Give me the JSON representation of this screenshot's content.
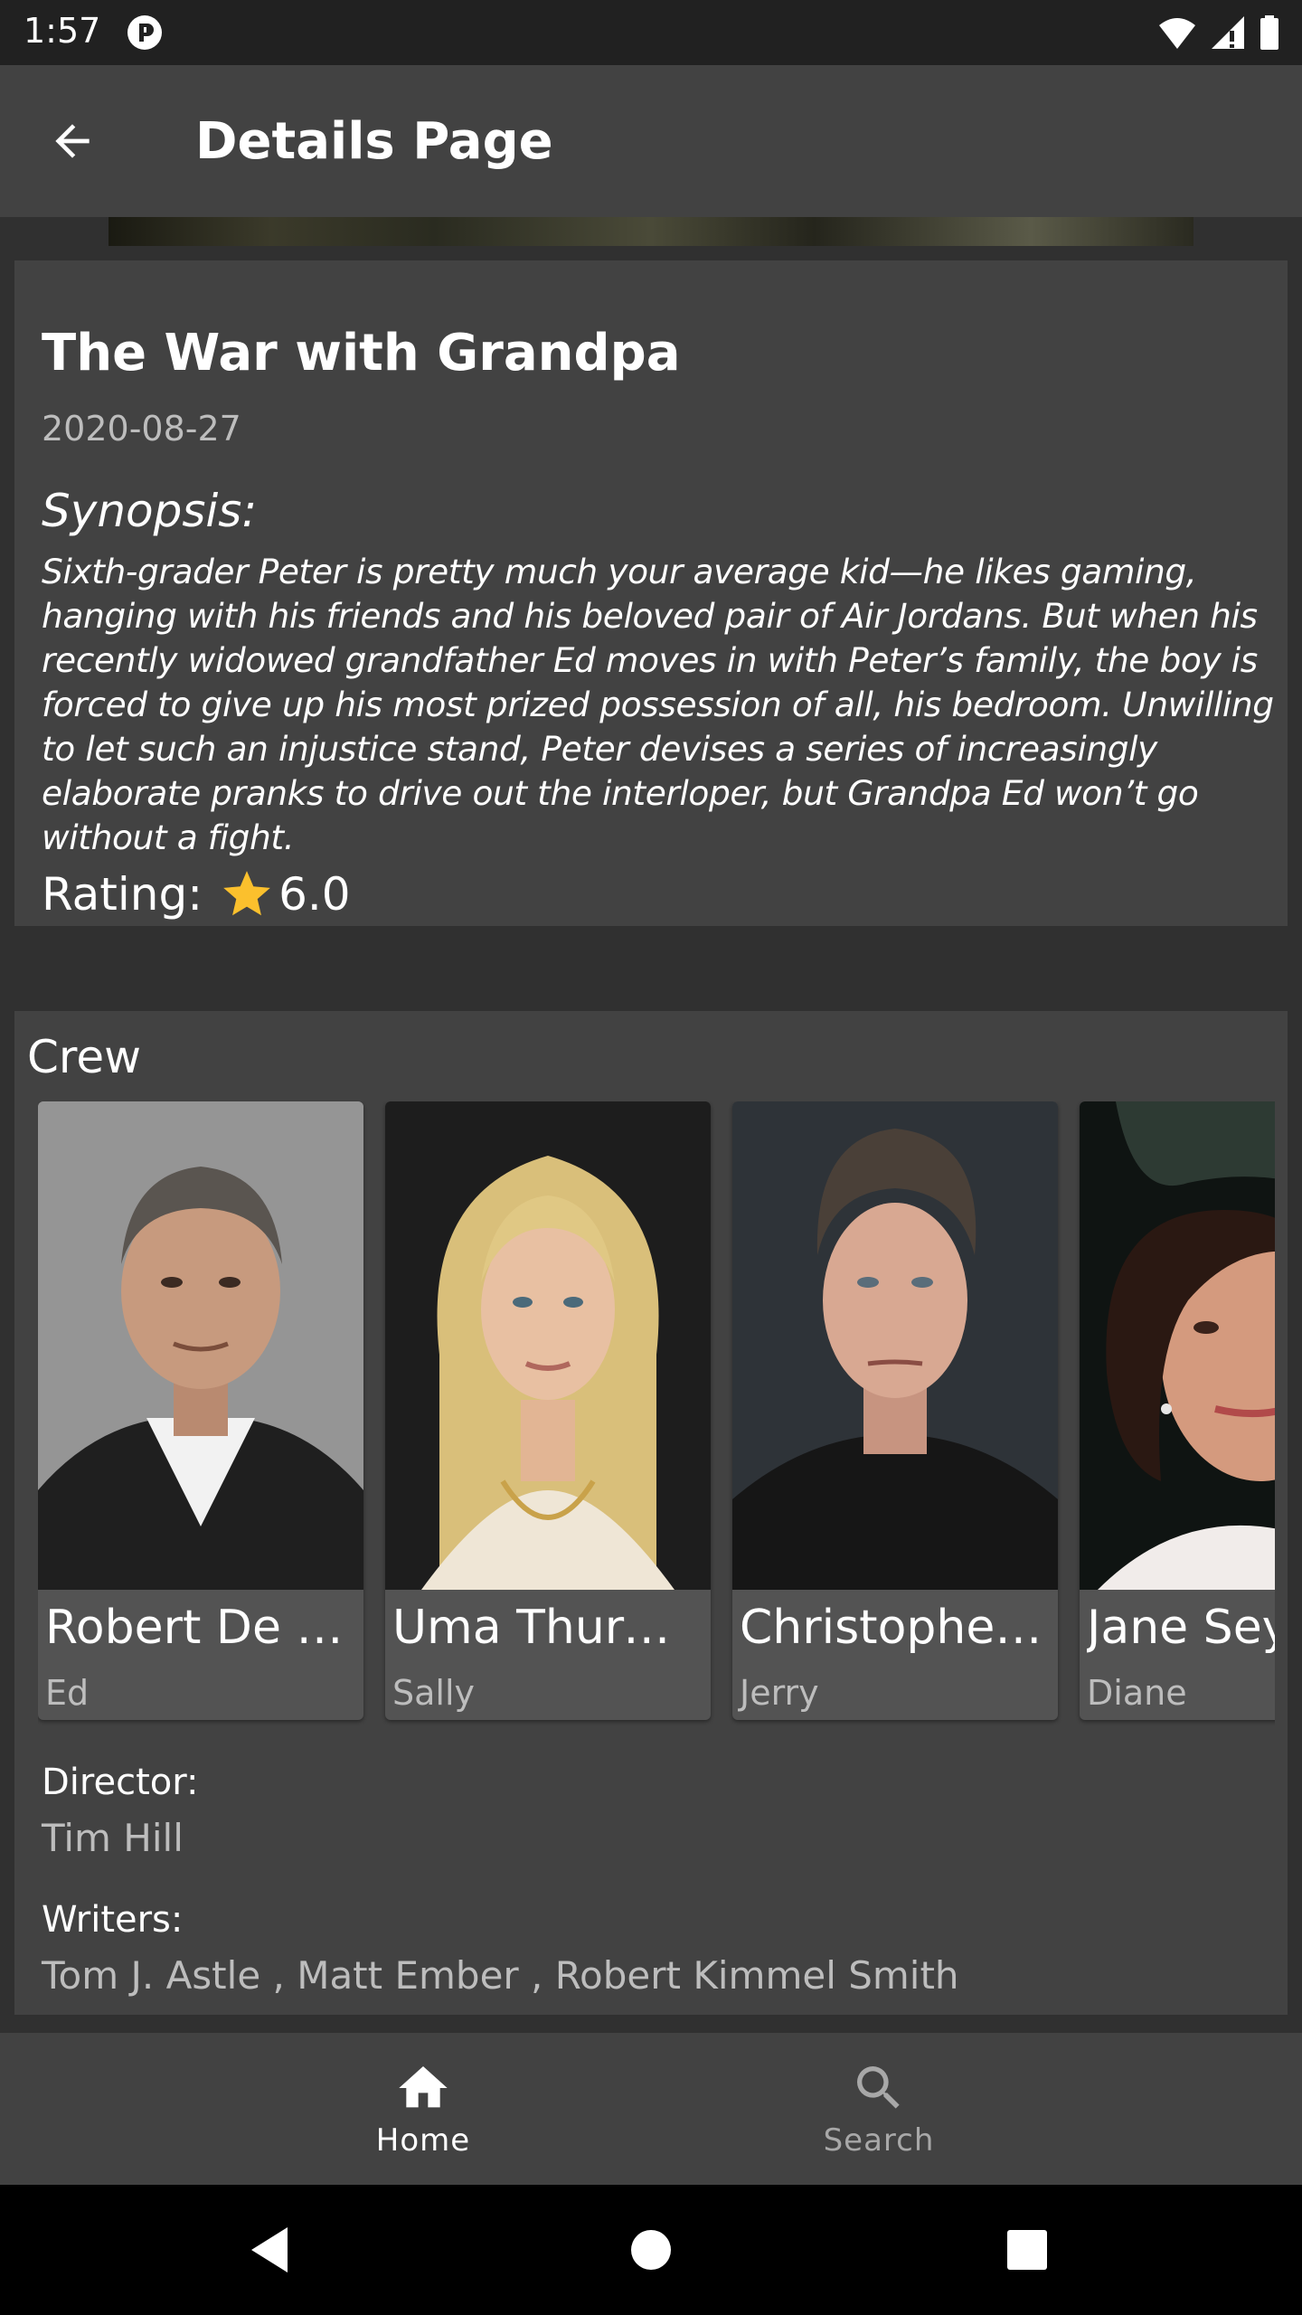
{
  "status_bar": {
    "time": "1:57",
    "icons": [
      "app-notification-icon",
      "wifi-icon",
      "signal-icon",
      "battery-icon"
    ]
  },
  "app_bar": {
    "title": "Details Page",
    "back_icon": "arrow-back-icon"
  },
  "movie": {
    "title": "The War with Grandpa",
    "release_date": "2020-08-27",
    "synopsis_label": "Synopsis:",
    "synopsis_lines": [
      "Sixth-grader Peter is pretty much your average kid—he likes gaming,",
      "hanging with his friends and his beloved pair of Air Jordans. But when his",
      "recently widowed grandfather Ed moves in with Peter’s family, the boy is",
      "forced to give up his most prized possession of all, his bedroom. Unwilling",
      "to let such an injustice stand, Peter devises a series of increasingly",
      "elaborate pranks to drive out the interloper, but Grandpa Ed won’t go",
      "without a fight."
    ],
    "rating_label": "Rating:",
    "rating_value": "6.0",
    "rating_icon": "star-icon",
    "star_color": "#FBC02D"
  },
  "crew": {
    "label": "Crew",
    "cast": [
      {
        "name": "Robert De Niro",
        "role": "Ed"
      },
      {
        "name": "Uma Thurman",
        "role": "Sally"
      },
      {
        "name": "Christopher Walken",
        "role": "Jerry"
      },
      {
        "name": "Jane Seymour",
        "role": "Diane"
      }
    ],
    "director_label": "Director:",
    "director": "Tim Hill",
    "writers_label": "Writers:",
    "writers": "Tom J. Astle , Matt Ember , Robert Kimmel Smith"
  },
  "bottom_nav": {
    "items": [
      {
        "label": "Home",
        "icon": "home-icon",
        "active": true
      },
      {
        "label": "Search",
        "icon": "search-icon",
        "active": false
      }
    ]
  },
  "system_nav": {
    "icons": [
      "back-triangle-icon",
      "home-circle-icon",
      "recents-square-icon"
    ]
  },
  "colors": {
    "background": "#303030",
    "card": "#424242",
    "app_bar": "#424242",
    "secondary_text": "#bdbdbd"
  }
}
